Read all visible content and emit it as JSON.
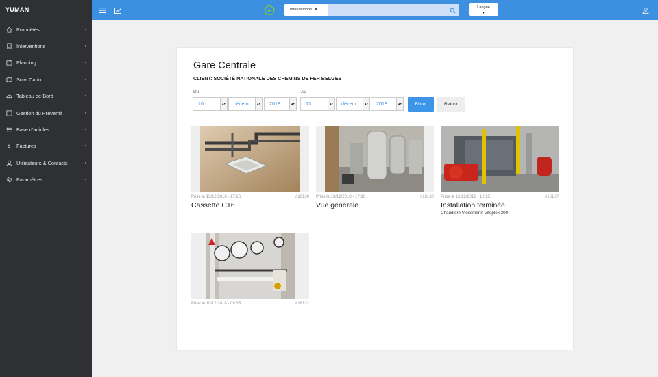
{
  "brand": "YUMAN",
  "sidebar": {
    "items": [
      {
        "label": "Propriétés",
        "icon": "home-icon"
      },
      {
        "label": "Interventions",
        "icon": "clipboard-icon"
      },
      {
        "label": "Planning",
        "icon": "calendar-icon"
      },
      {
        "label": "Suivi Carto",
        "icon": "map-icon"
      },
      {
        "label": "Tableau de Bord",
        "icon": "gauge-icon"
      },
      {
        "label": "Gestion du Préventif",
        "icon": "square-icon"
      },
      {
        "label": "Base d'articles",
        "icon": "list-icon"
      },
      {
        "label": "Factures",
        "icon": "dollar-icon"
      },
      {
        "label": "Utilisateurs & Contacts",
        "icon": "user-icon"
      },
      {
        "label": "Paramètres",
        "icon": "gear-icon"
      }
    ]
  },
  "topbar": {
    "search_scope": "Interventions",
    "search_placeholder": "",
    "language_label": "Langue",
    "accent": "#3d8fe0"
  },
  "page": {
    "title": "Gare Centrale",
    "client": "CLIENT: SOCIÉTÉ NATIONALE DES CHEMINS DE FER BELGES"
  },
  "filter": {
    "from_label": "Du",
    "to_label": "Au",
    "from_day": "10",
    "from_month": "décem",
    "from_year": "2018",
    "to_day": "13",
    "to_month": "décem",
    "to_year": "2018",
    "filter_button": "Filtrer",
    "back_button": "Retour"
  },
  "photos": [
    {
      "date": "Prise le 13/12/2018 - 17:16",
      "id": "#16130",
      "caption": "Cassette C16",
      "subtitle": ""
    },
    {
      "date": "Prise le 13/12/2018 - 17:16",
      "id": "#16130",
      "caption": "Vue générale",
      "subtitle": ""
    },
    {
      "date": "Prise le 12/12/2018 - 12:25",
      "id": "#16127",
      "caption": "Installation terminée",
      "subtitle": "Chaudière Viessmann Vitoplex 300"
    },
    {
      "date": "Prise le 10/12/2018 - 09:35",
      "id": "#16122",
      "caption": "",
      "subtitle": ""
    }
  ]
}
